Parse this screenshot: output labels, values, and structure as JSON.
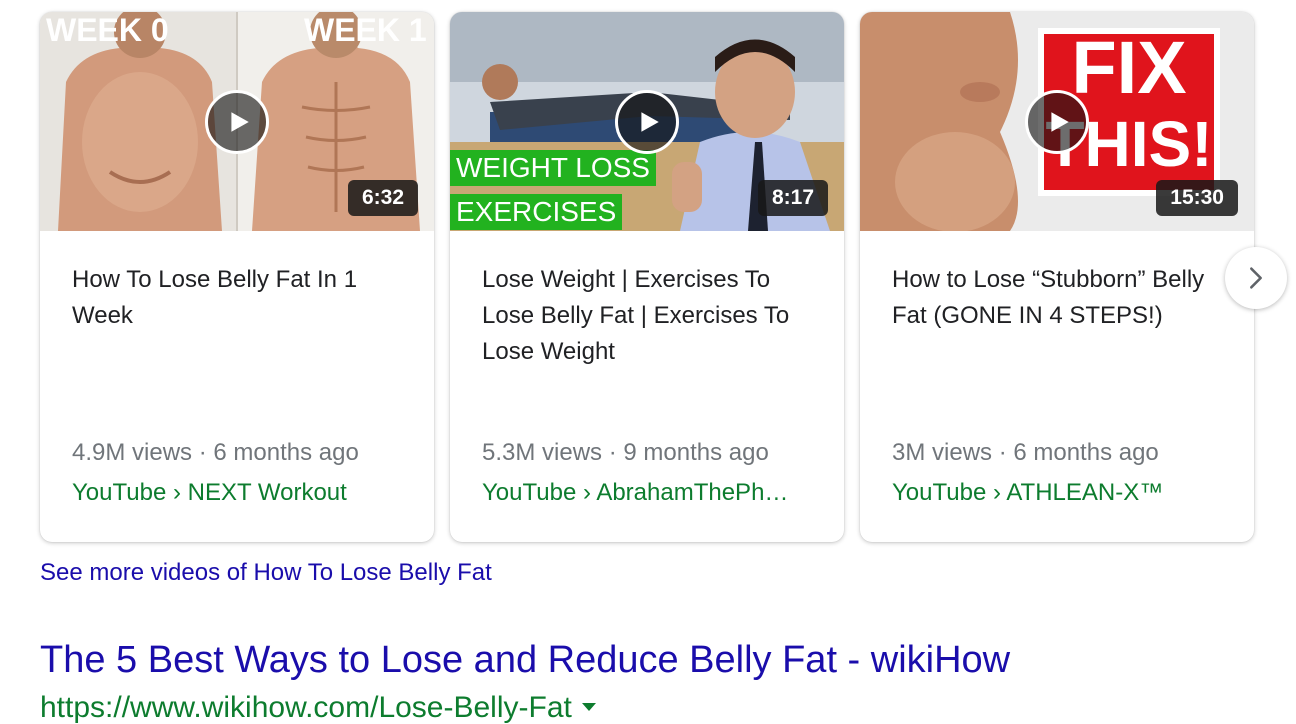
{
  "videos": [
    {
      "duration": "6:32",
      "title": "How To Lose Belly Fat In 1 Week",
      "meta": "4.9M views · 6 months ago",
      "source": "YouTube › NEXT Workout",
      "overlay_left": "WEEK 0",
      "overlay_right": "WEEK 1"
    },
    {
      "duration": "8:17",
      "title": "Lose Weight | Exercises To Lose Belly Fat | Exercises To Lose Weight",
      "meta": "5.3M views · 9 months ago",
      "source": "YouTube › AbrahamThePh…",
      "overlay_line1": "WEIGHT LOSS",
      "overlay_line2": "EXERCISES"
    },
    {
      "duration": "15:30",
      "title": "How to Lose “Stubborn” Belly Fat (GONE IN 4 STEPS!)",
      "meta": "3M views · 6 months ago",
      "source": "YouTube › ATHLEAN-X™",
      "overlay_line1": "FIX",
      "overlay_line2": "THIS!"
    }
  ],
  "see_more": "See more videos of How To Lose Belly Fat",
  "result": {
    "title": "The 5 Best Ways to Lose and Reduce Belly Fat - wikiHow",
    "url": "https://www.wikihow.com/Lose-Belly-Fat"
  },
  "colors": {
    "link_blue": "#1a0dab",
    "source_green": "#0d7c2e",
    "meta_gray": "#70757a",
    "text_dark": "#202124",
    "overlay_green": "#22b21f",
    "fix_red": "#e0141c"
  },
  "icons": {
    "play": "play-icon",
    "next": "chevron-right-icon",
    "url_menu": "caret-down-icon"
  }
}
